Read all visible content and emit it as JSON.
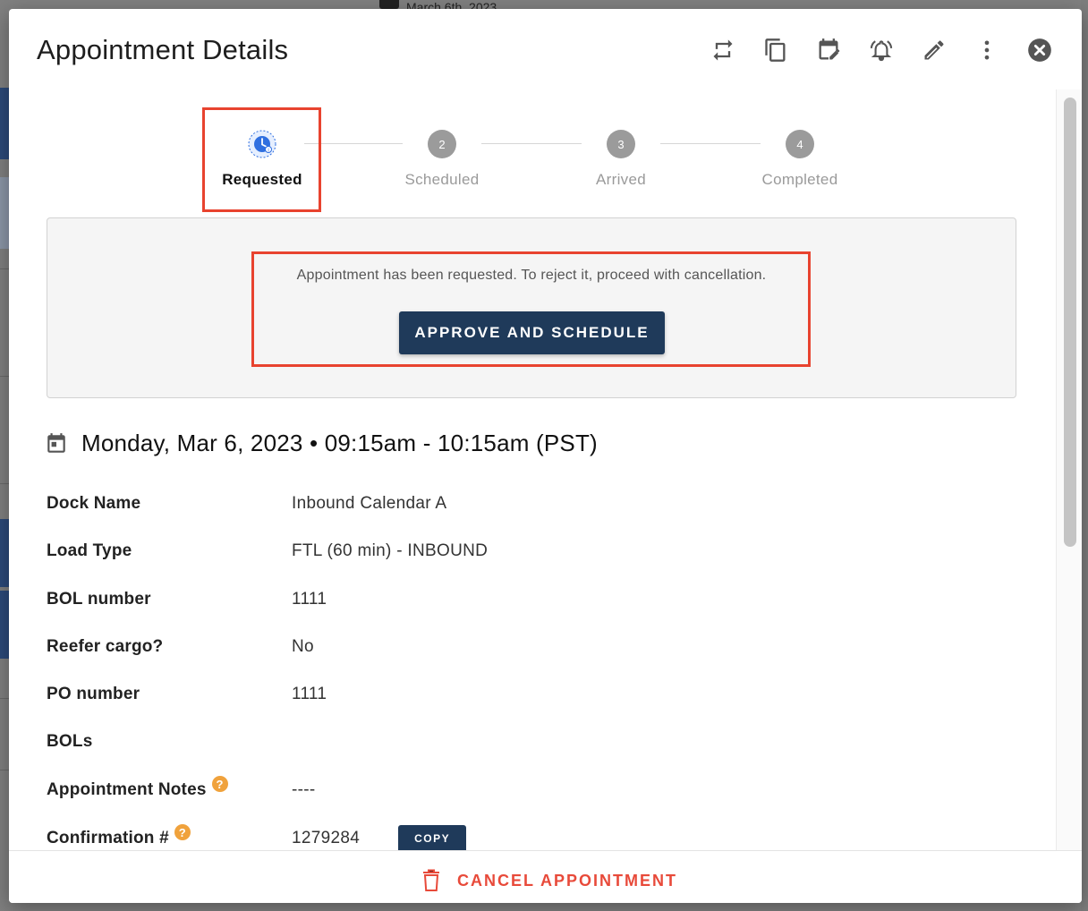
{
  "background": {
    "top_date_fragment": "March 6th, 2023"
  },
  "dialog": {
    "title": "Appointment Details",
    "header_icons": [
      {
        "name": "repeat-icon"
      },
      {
        "name": "copy-icon"
      },
      {
        "name": "reschedule-calendar-icon"
      },
      {
        "name": "alarm-bell-icon"
      },
      {
        "name": "edit-pencil-icon"
      },
      {
        "name": "more-vert-icon"
      },
      {
        "name": "close-circle-icon"
      }
    ]
  },
  "stepper": {
    "steps": [
      {
        "number": "",
        "label": "Requested",
        "active": true
      },
      {
        "number": "2",
        "label": "Scheduled",
        "active": false
      },
      {
        "number": "3",
        "label": "Arrived",
        "active": false
      },
      {
        "number": "4",
        "label": "Completed",
        "active": false
      }
    ]
  },
  "status": {
    "message": "Appointment has been requested. To reject it, proceed with cancellation.",
    "approve_label": "APPROVE AND SCHEDULE"
  },
  "appointment": {
    "date_time": "Monday, Mar 6, 2023  •  09:15am - 10:15am (PST)"
  },
  "details": {
    "rows": [
      {
        "key": "Dock Name",
        "value": "Inbound Calendar A"
      },
      {
        "key": "Load Type",
        "value": "FTL (60 min) - INBOUND"
      },
      {
        "key": "BOL number",
        "value": "1111"
      },
      {
        "key": "Reefer cargo?",
        "value": "No"
      },
      {
        "key": "PO number",
        "value": "1111"
      },
      {
        "key": "BOLs",
        "value": ""
      },
      {
        "key": "Appointment Notes",
        "value": "----",
        "help": "?"
      },
      {
        "key": "Confirmation #",
        "value": "1279284",
        "help": "?",
        "action": "COPY"
      }
    ]
  },
  "footer": {
    "cancel_label": "CANCEL APPOINTMENT"
  },
  "colors": {
    "primary": "#1f3a5a",
    "highlight": "#e8432f",
    "danger": "#e84a3a",
    "help": "#f0a23c",
    "active_step": "#2f6fe0"
  }
}
